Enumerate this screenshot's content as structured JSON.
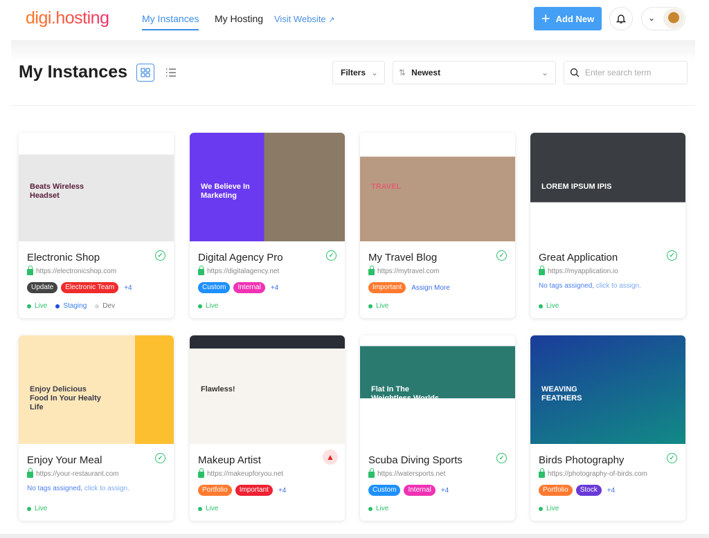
{
  "header": {
    "logo": "digi.hosting",
    "nav": [
      {
        "label": "My Instances",
        "active": true
      },
      {
        "label": "My Hosting"
      }
    ],
    "visit_link": "Visit Website",
    "add_new": "Add New"
  },
  "toolbar": {
    "title": "My Instances",
    "filters": "Filters",
    "sort": "Newest",
    "search_placeholder": "Enter search term"
  },
  "colors": {
    "accent": "#449ff5",
    "live": "#2bbf6a",
    "staging": "#1a4fe0",
    "dev": "#d8dae0"
  },
  "cards": [
    {
      "title": "Electronic Shop",
      "url": "https://electronicshop.com",
      "status": "ok",
      "thumb_headline": "Beats Wireless Headset",
      "thumb_bg": "linear-gradient(#fff 0 20%,#e8e8e8 20%)",
      "thumb_color": "#5a1e3a",
      "tags": [
        {
          "label": "Update",
          "color": "#444444"
        },
        {
          "label": "Electronic Team",
          "color": "#f02b2b"
        }
      ],
      "more": "+4",
      "envs": [
        {
          "label": "Live",
          "color": "#2bbf6a",
          "text": "#2bbf6a"
        },
        {
          "label": "Staging",
          "color": "#1a4fe0",
          "text": "#3a7ee8"
        },
        {
          "label": "Dev",
          "color": "#d8dae0",
          "text": "#777"
        }
      ]
    },
    {
      "title": "Digital Agency Pro",
      "url": "https://digitalagency.net",
      "status": "ok",
      "thumb_headline": "We Believe In Marketing",
      "thumb_bg": "linear-gradient(90deg,#6a3af0 0 48%,#8a7a66 48%)",
      "thumb_color": "#fff",
      "tags": [
        {
          "label": "Custom",
          "color": "#1e90ff"
        },
        {
          "label": "Internal",
          "color": "#f032b4"
        }
      ],
      "more": "+4",
      "envs": [
        {
          "label": "Live",
          "color": "#2bbf6a",
          "text": "#2bbf6a"
        }
      ]
    },
    {
      "title": "My Travel Blog",
      "url": "https://mytravel.com",
      "status": "ok",
      "thumb_headline": "TRAVEL",
      "thumb_bg": "linear-gradient(#fff 0 22%,#b89a82 22%)",
      "thumb_color": "#e06070",
      "tags": [
        {
          "label": "Important",
          "color": "#ff7a2f"
        }
      ],
      "assign_more": "Assign More",
      "envs": [
        {
          "label": "Live",
          "color": "#2bbf6a",
          "text": "#2bbf6a"
        }
      ]
    },
    {
      "title": "Great Application",
      "url": "https://myapplication.io",
      "status": "ok",
      "thumb_headline": "LOREM IPSUM IPIS",
      "thumb_bg": "linear-gradient(#3a3e42 0 64%,#fff 64%)",
      "thumb_color": "#fff",
      "no_tags": "No tags assigned,",
      "no_tags_link": "click to assign.",
      "envs": [
        {
          "label": "Live",
          "color": "#2bbf6a",
          "text": "#2bbf6a"
        }
      ]
    },
    {
      "title": "Enjoy Your Meal",
      "url": "https://your-restaurant.com",
      "status": "ok",
      "thumb_headline": "Enjoy Delicious Food In Your Healty Life",
      "thumb_bg": "linear-gradient(90deg,#fde7b8 0 75%,#fcbf30 75%)",
      "thumb_color": "#3a3a4a",
      "no_tags": "No tags assigned,",
      "no_tags_link": "click to assign.",
      "envs": [
        {
          "label": "Live",
          "color": "#2bbf6a",
          "text": "#2bbf6a"
        }
      ]
    },
    {
      "title": "Makeup Artist",
      "url": "https://makeupforyou.net",
      "status": "warning",
      "thumb_headline": "Flawless!",
      "thumb_bg": "linear-gradient(#2a2d36 0 12%,#f7f3ee 12%)",
      "thumb_color": "#333",
      "tags": [
        {
          "label": "Portfolio",
          "color": "#ff7a2f"
        },
        {
          "label": "Important",
          "color": "#ee2233"
        }
      ],
      "more": "+4",
      "envs": [
        {
          "label": "Live",
          "color": "#2bbf6a",
          "text": "#2bbf6a"
        }
      ]
    },
    {
      "title": "Scuba Diving Sports",
      "url": "https://watersports.net",
      "status": "ok",
      "thumb_headline": "Flat In The Weightless Worlds",
      "thumb_bg": "linear-gradient(#fff 0 10%,#2a7a70 10% 58%,#fff 58%)",
      "thumb_color": "#fff",
      "tags": [
        {
          "label": "Custom",
          "color": "#1e90ff"
        },
        {
          "label": "Internal",
          "color": "#f032b4"
        }
      ],
      "more": "+4",
      "envs": [
        {
          "label": "Live",
          "color": "#2bbf6a",
          "text": "#2bbf6a"
        }
      ]
    },
    {
      "title": "Birds Photography",
      "url": "https://photography-of-birds.com",
      "status": "ok",
      "thumb_headline": "WEAVING FEATHERS",
      "thumb_bg": "linear-gradient(160deg,#1a3c9a,#128a86)",
      "thumb_color": "#fff",
      "tags": [
        {
          "label": "Portfolio",
          "color": "#ff7a2f"
        },
        {
          "label": "Stock",
          "color": "#6a3ad8"
        }
      ],
      "more": "+4",
      "envs": [
        {
          "label": "Live",
          "color": "#2bbf6a",
          "text": "#2bbf6a"
        }
      ]
    }
  ]
}
